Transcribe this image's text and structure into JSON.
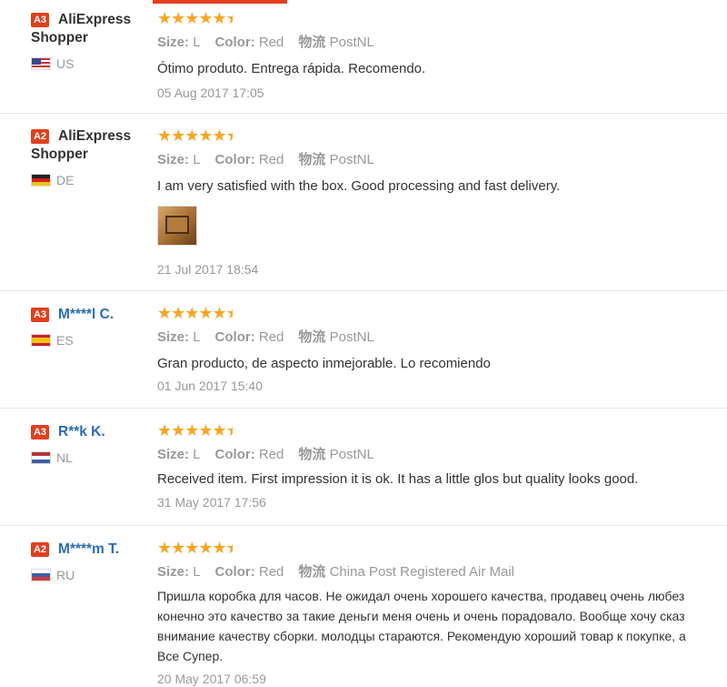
{
  "labels": {
    "size": "Size:",
    "color": "Color:",
    "shipping": "物流"
  },
  "colors": {
    "badge": "#e0401e",
    "star": "#f5a623",
    "link": "#2a6bb5",
    "accent": "#e53e1e"
  },
  "reviews": [
    {
      "badge": "A3",
      "user": "AliExpress Shopper",
      "country": "US",
      "flag": "flag-us-icon",
      "rating": 4.5,
      "size": "L",
      "color": "Red",
      "shipping": "PostNL",
      "text": "Ótimo produto. Entrega rápida. Recomendo.",
      "date": "05 Aug 2017 17:05"
    },
    {
      "badge": "A2",
      "user": "AliExpress Shopper",
      "country": "DE",
      "flag": "flag-de-icon",
      "rating": 4.5,
      "size": "L",
      "color": "Red",
      "shipping": "PostNL",
      "text": "I am very satisfied with the box. Good processing and fast delivery.",
      "date": "21 Jul 2017 18:54",
      "photo": "box-photo"
    },
    {
      "badge": "A3",
      "user": "M****l C.",
      "country": "ES",
      "flag": "flag-es-icon",
      "rating": 4.5,
      "size": "L",
      "color": "Red",
      "shipping": "PostNL",
      "text": "Gran producto, de aspecto inmejorable. Lo recomiendo",
      "date": "01 Jun 2017 15:40"
    },
    {
      "badge": "A3",
      "user": "R**k K.",
      "country": "NL",
      "flag": "flag-nl-icon",
      "rating": 4.5,
      "size": "L",
      "color": "Red",
      "shipping": "PostNL",
      "text": "Received item. First impression it is ok. It has a little glos but quality looks good.",
      "date": "31 May 2017 17:56"
    },
    {
      "badge": "A2",
      "user": "M****m T.",
      "country": "RU",
      "flag": "flag-ru-icon",
      "rating": 4.5,
      "size": "L",
      "color": "Red",
      "shipping": "China Post Registered Air Mail",
      "text_lines": [
        "Пришла коробка для часов. Не ожидал очень хорошего качества, продавец очень любез",
        "конечно это качество за такие деньги меня очень и очень порадовало. Вообще хочу сказ",
        "внимание качеству сборки. молодцы стараются. Рекомендую хороший товар к покупке, а",
        "Все Супер."
      ],
      "date": "20 May 2017 06:59"
    }
  ]
}
